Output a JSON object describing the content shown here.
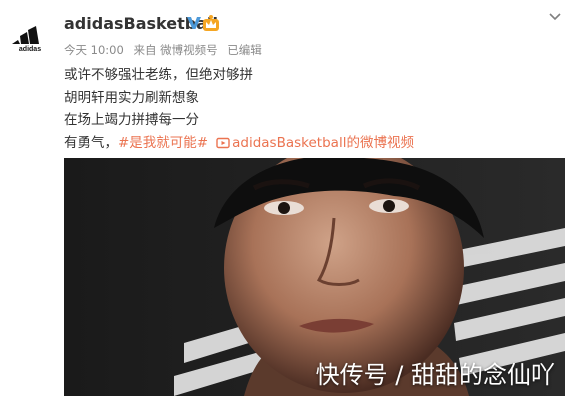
{
  "post": {
    "username": "adidasBasketball",
    "meta": {
      "time": "今天 10:00",
      "source": "来自 微博视频号",
      "edited": "已编辑"
    },
    "lines": [
      "或许不够强壮老练，但绝对够拼",
      "胡明轩用实力刷新想象",
      "在场上竭力拼搏每一分"
    ],
    "last_line": {
      "prefix": "有勇气，",
      "hashtag": "#是我就可能#",
      "video_link": "adidasBasketball的微博视频"
    }
  },
  "video": {
    "watermark": "快传号 / 甜甜的念仙吖"
  },
  "icons": {
    "avatar": "adidas-logo-icon",
    "verified": "verified-v-icon",
    "member": "member-crown-icon",
    "menu": "chevron-down-icon",
    "video": "video-play-icon"
  },
  "colors": {
    "link": "#eb7350",
    "verified": "#4e9ad9",
    "member": "#f5a623",
    "meta": "#8a8a8a",
    "text": "#333333"
  }
}
